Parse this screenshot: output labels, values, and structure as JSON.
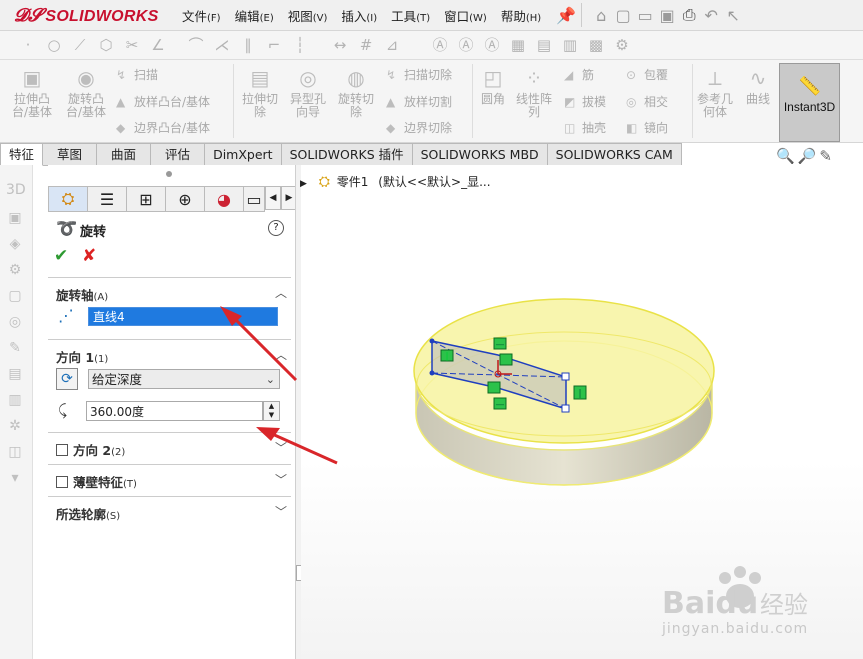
{
  "app": {
    "logo": "SOLIDWORKS"
  },
  "menu": [
    {
      "label": "文件",
      "key": "(F)"
    },
    {
      "label": "编辑",
      "key": "(E)"
    },
    {
      "label": "视图",
      "key": "(V)"
    },
    {
      "label": "插入",
      "key": "(I)"
    },
    {
      "label": "工具",
      "key": "(T)"
    },
    {
      "label": "窗口",
      "key": "(W)"
    },
    {
      "label": "帮助",
      "key": "(H)"
    }
  ],
  "ribbon": {
    "extrude_boss": "拉伸凸台/基体",
    "revolve_boss": "旋转凸台/基体",
    "sweep": "扫描",
    "loft_boss": "放样凸台/基体",
    "boundary_boss": "边界凸台/基体",
    "extrude_cut": "拉伸切除",
    "hole_wizard": "异型孔向导",
    "revolve_cut": "旋转切除",
    "swept_cut": "扫描切除",
    "lofted_cut": "放样切割",
    "boundary_cut": "边界切除",
    "fillet": "圆角",
    "linear_pattern": "线性阵列",
    "rib": "筋",
    "draft": "拔模",
    "shell": "抽壳",
    "wrap": "包覆",
    "intersect": "相交",
    "mirror": "镜向",
    "ref_geometry": "参考几何体",
    "curves": "曲线",
    "instant3d": "Instant3D"
  },
  "tabs": [
    "特征",
    "草图",
    "曲面",
    "评估",
    "DimXpert",
    "SOLIDWORKS 插件",
    "SOLIDWORKS MBD",
    "SOLIDWORKS CAM"
  ],
  "tree": {
    "part_name": "零件1",
    "config": "(默认<<默认>_显..."
  },
  "pm": {
    "title": "旋转",
    "axis_section": "旋转轴",
    "axis_section_key": "(A)",
    "axis_value": "直线4",
    "dir1_section": "方向 1",
    "dir1_key": "(1)",
    "end_condition": "给定深度",
    "angle_value": "360.00度",
    "dir2_section": "方向 2",
    "dir2_key": "(2)",
    "thin_section": "薄壁特征",
    "thin_key": "(T)",
    "contours_section": "所选轮廓",
    "contours_key": "(S)"
  },
  "watermark": {
    "brand": "Baidu",
    "brand_cn": "经验",
    "url": "jingyan.baidu.com"
  },
  "colors": {
    "accent_red": "#c8102e",
    "selection_blue": "#1f7ae0",
    "annotation_arrow": "#d9262a",
    "disc_yellow": "#f7f3a0"
  }
}
